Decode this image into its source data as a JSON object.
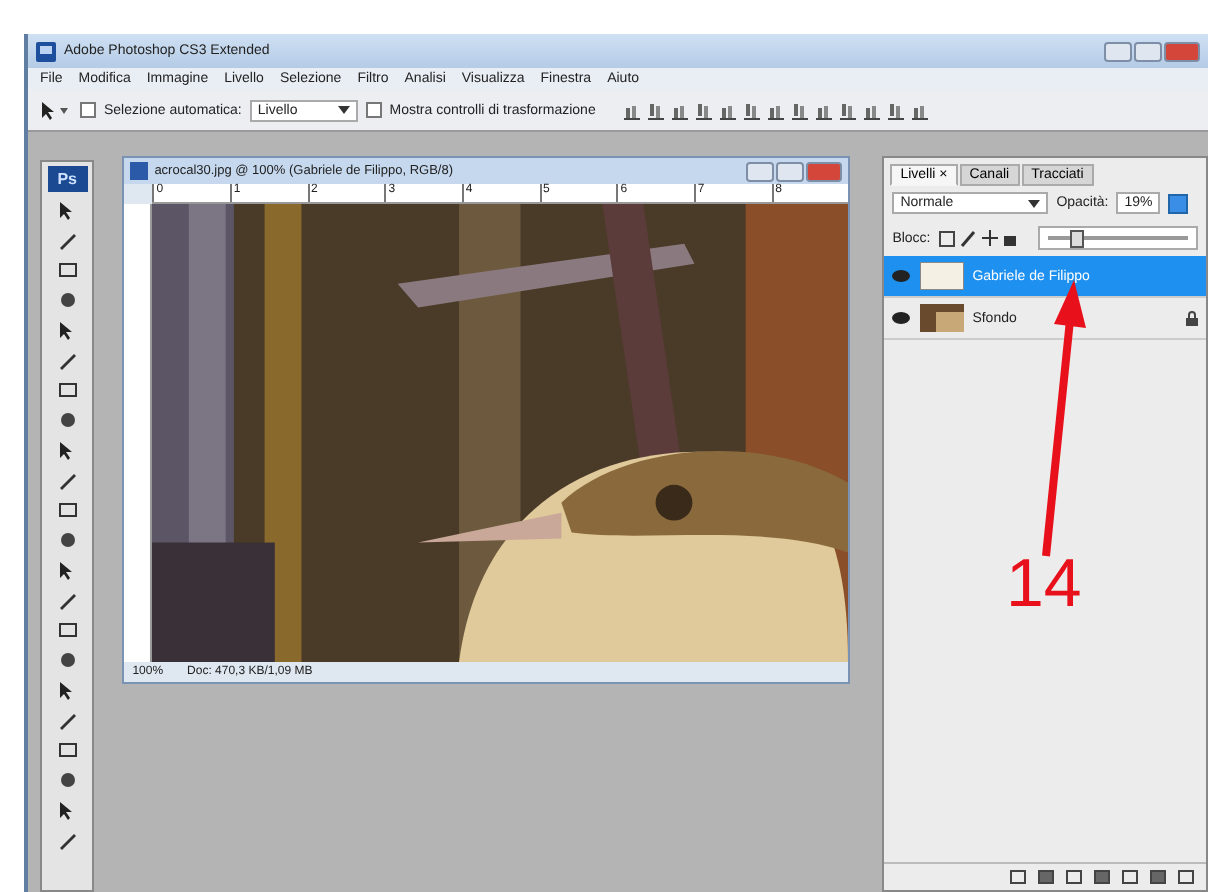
{
  "window": {
    "title": "Adobe Photoshop CS3 Extended"
  },
  "menu": [
    "File",
    "Modifica",
    "Immagine",
    "Livello",
    "Selezione",
    "Filtro",
    "Analisi",
    "Visualizza",
    "Finestra",
    "Aiuto"
  ],
  "options": {
    "auto_select": {
      "label": "Selezione automatica:",
      "checked": false
    },
    "target": "Livello",
    "transform_controls": {
      "label": "Mostra controlli di trasformazione",
      "checked": false
    }
  },
  "toolbox": {
    "logo": "Ps"
  },
  "document": {
    "title": "acrocal30.jpg @ 100% (Gabriele de Filippo, RGB/8)",
    "ruler": [
      "0",
      "1",
      "2",
      "3",
      "4",
      "5",
      "6",
      "7",
      "8"
    ],
    "zoom": "100%",
    "doc_size": "Doc: 470,3 KB/1,09 MB"
  },
  "layers_panel": {
    "tabs": [
      {
        "label": "Livelli ×",
        "selected": true
      },
      {
        "label": "Canali",
        "selected": false
      },
      {
        "label": "Tracciati",
        "selected": false
      }
    ],
    "blend_mode": "Normale",
    "opacity_label": "Opacità:",
    "opacity": "19%",
    "opacity_slider": {
      "level": 0.19
    },
    "lock_label": "Blocc:",
    "layers": [
      {
        "name": "Gabriele de Filippo",
        "selected": true,
        "visible": true,
        "locked": false
      },
      {
        "name": "Sfondo",
        "selected": false,
        "visible": true,
        "locked": true
      }
    ]
  },
  "annotation": {
    "label": "14"
  }
}
